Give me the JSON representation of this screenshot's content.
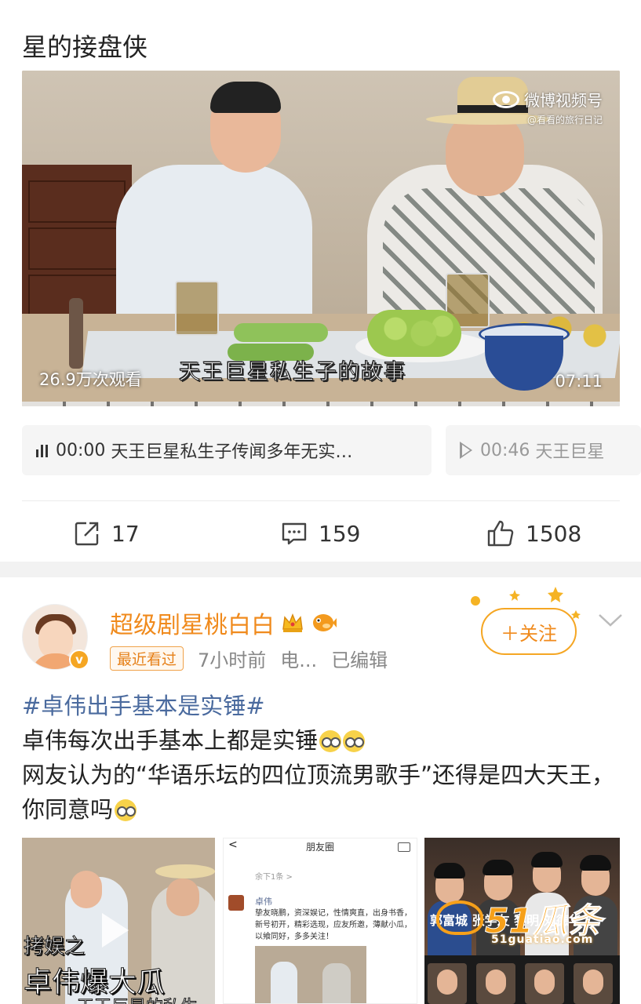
{
  "prev_post": {
    "title_tail": "星的接盘侠",
    "video": {
      "watermark_brand": "微博视频号",
      "watermark_account": "@看看的旅行日记",
      "caption": "天王巨星私生子的故事",
      "views": "26.9万次观看",
      "duration": "07:11"
    },
    "chapters": [
      {
        "time": "00:00",
        "title": "天王巨星私生子传闻多年无实…",
        "state": "playing",
        "icon": "audio-bars-icon"
      },
      {
        "time": "00:46",
        "title": "天王巨星",
        "state": "idle",
        "icon": "play-icon"
      }
    ],
    "actions": {
      "repost": {
        "icon": "repost-icon",
        "count": "17"
      },
      "comment": {
        "icon": "comment-icon",
        "count": "159"
      },
      "like": {
        "icon": "like-icon",
        "count": "1508"
      }
    }
  },
  "post": {
    "author": {
      "name": "超级剧星桃白白",
      "badges": [
        "crown-icon",
        "pufferfish-icon"
      ],
      "verified": "v",
      "recent_badge": "最近看过",
      "time": "7小时前",
      "source": "电...",
      "edited": "已编辑"
    },
    "follow_label": "＋关注",
    "hashtag": "#卓伟出手基本是实锤#",
    "line1": "卓伟每次出手基本上都是实锤",
    "line2": "网友认为的“华语乐坛的四位顶流男歌手”还得是四大天王，你同意吗",
    "images": {
      "img1": {
        "cap1": "拷娱之",
        "cap2": "卓伟爆大瓜",
        "cap3": "天王巨星的私生"
      },
      "img2": {
        "header": "朋友圈",
        "back": "<",
        "more": "余下1条 >",
        "name": "卓伟",
        "body": "挚友晓鹏，资深娱记，性情爽直，出身书香，新号初开，精彩选现，应友所邀，薄献小瓜，以飨同好，多多关注！"
      },
      "img3": {
        "names": "郭富城 张学友 黎明 刘德华"
      }
    },
    "watermark": {
      "brand": "51瓜条",
      "url": "51guatiao.com"
    }
  },
  "colors": {
    "accent": "#f08a1c",
    "hashtag": "#4a6a9e",
    "meta": "#888888"
  }
}
